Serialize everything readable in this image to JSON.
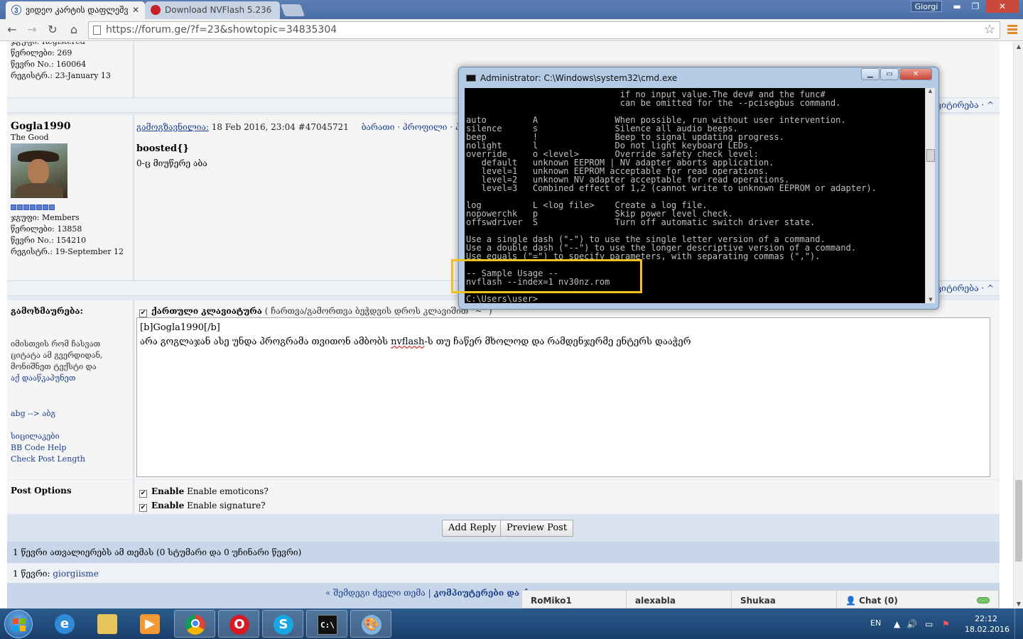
{
  "browser": {
    "tabs": [
      {
        "title": "ვიდეო კარტის დაფლეშვ",
        "active": true
      },
      {
        "title": "Download NVFlash 5.236",
        "active": false
      }
    ],
    "user_badge": "Giorgi",
    "url": "https://forum.ge/?f=23&showtopic=34835304",
    "window_buttons": {
      "minimize": "▬",
      "maximize": "❐",
      "close": "✕"
    }
  },
  "prev_post_user": {
    "group_partial": "ჯგუფი: Registered",
    "posts": "წერილები: 269",
    "member_no": "წევრი No.: 160064",
    "registered": "რეგისტრ.: 23-January 13"
  },
  "strip_links": "ციტირება · ^",
  "post": {
    "author": "Gogla1990",
    "title": "The Good",
    "group": "ჯგუფი: Members",
    "posts": "წერილები: 13858",
    "member_no": "წევრი No.: 154210",
    "registered": "რეგისტრ.: 19-September 12",
    "meta_label": "გამოგზავნილია:",
    "meta_date": "18 Feb 2016, 23:04",
    "meta_id": "#47045721",
    "meta_links": "ბარათი · პროფილი · პირადი",
    "heading": "boosted{}",
    "body": "0-ც მიუწერე აბა"
  },
  "reply": {
    "label": "გამოხმაურება:",
    "keyboard_checkbox_label": "ქართული კლავიატურა",
    "keyboard_hint": "( ჩართვა/გამორთვა ბეჭდვის დროს კლავიშით \"~\" )",
    "help_text": [
      "იმისთვის რომ ჩასვათ",
      "ციტატა ამ გვერდიდან,",
      "მონიშნეთ ტექსტი და"
    ],
    "help_link": "აქ დააწკაპუნეთ",
    "abg_link": "abg --> აბგ",
    "smilies_link": "სიცილაკები",
    "bbcode_link": "BB Code Help",
    "check_length_link": "Check Post Length",
    "text_line1": "[b]Gogla1990[/b]",
    "text_line2_a": "არა გოგლაჯან ასე უნდა პროგრამა თვითონ ამბობს ",
    "text_line2_b": "nvflash",
    "text_line2_c": "-ს თუ ჩაწერ მხოლოდ და რამდენჯერმე ენტერს დააჭერ"
  },
  "post_options": {
    "label": "Post Options",
    "emoticons": "Enable emoticons?",
    "signature": "Enable signature?"
  },
  "buttons": {
    "add_reply": "Add Reply",
    "preview_post": "Preview Post"
  },
  "readers": "1 წევრი ათვალიერებს ამ თემას (0 სტუმარი და 0 უჩინარი წევრი)",
  "members_line_label": "1 წევრი: ",
  "members_line_name": "giorgiisme",
  "footer_nav": "« შემდეგი ძველი თემა | ",
  "footer_category": "კომპიუტერები და ქ",
  "chat": {
    "users": [
      "RoMiko1",
      "alexabla",
      "Shukaa"
    ],
    "chat_label": "Chat (0)"
  },
  "cmd": {
    "title": "Administrator: C:\\Windows\\system32\\cmd.exe",
    "lines": [
      "                              if no input value.The dev# and the func#",
      "                              can be omitted for the --pcisegbus command.",
      "",
      "auto         A               When possible, run without user intervention.",
      "silence      s               Silence all audio beeps.",
      "beep         !               Beep to signal updating progress.",
      "nolight      l               Do not light keyboard LEDs.",
      "override     o <level>       Override safety check level:",
      "   default   unknown EEPROM | NV adapter aborts application.",
      "   level=1   unknown EEPROM acceptable for read operations.",
      "   level=2   unknown NV adapter acceptable for read operations.",
      "   level=3   Combined effect of 1,2 (cannot write to unknown EEPROM or adapter).",
      "",
      "log          L <log file>    Create a log file.",
      "nopowerchk   p               Skip power level check.",
      "offswdriver  S               Turn off automatic switch driver state.",
      "",
      "Use a single dash (\"-\") to use the single letter version of a command.",
      "Use a double dash (\"--\") to use the longer descriptive version of a command.",
      "Use equals (\"=\") to specify parameters, with separating commas (\",\").",
      "",
      "-- Sample Usage --",
      "nvflash --index=1 nv30nz.rom",
      "",
      "C:\\Users\\user>"
    ]
  },
  "taskbar": {
    "apps": [
      "windows-explorer",
      "internet-explorer",
      "file-explorer",
      "media-player",
      "chrome",
      "opera",
      "skype",
      "cmd",
      "paint"
    ],
    "lang": "EN",
    "time": "22:12",
    "date": "18.02.2016"
  }
}
